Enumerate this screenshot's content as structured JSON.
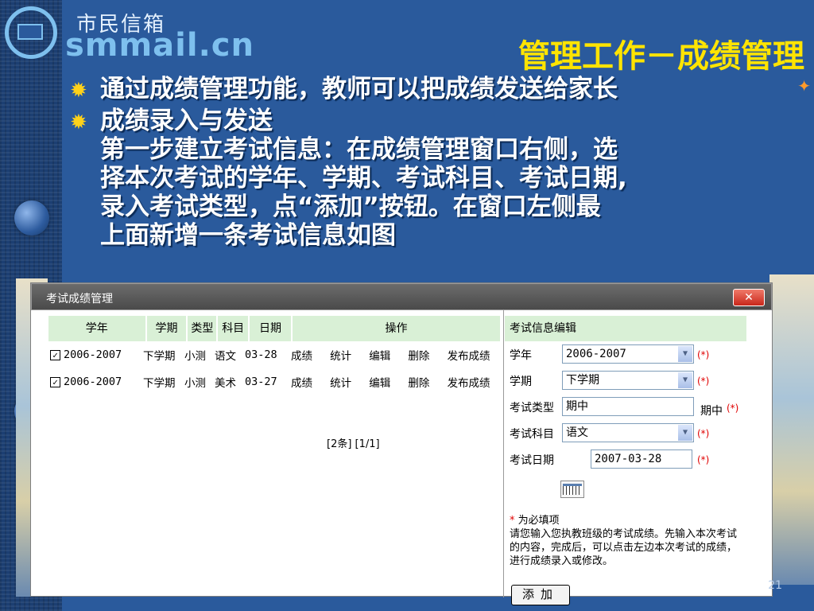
{
  "logo": {
    "cn": "市民信箱",
    "en": "smmail.cn"
  },
  "slide": {
    "title": "管理工作－成绩管理",
    "bullets": [
      "通过成绩管理功能，教师可以把成绩发送给家长",
      "成绩录入与发送"
    ],
    "steps": [
      "第一步建立考试信息：在成绩管理窗口右侧，选",
      "择本次考试的学年、学期、考试科目、考试日期,",
      "录入考试类型，点“添加”按钮。在窗口左侧最",
      "上面新增一条考试信息如图"
    ],
    "page_number": "21"
  },
  "window": {
    "title": "考试成绩管理",
    "close_label": "✕",
    "table": {
      "headers": [
        "学年",
        "学期",
        "类型",
        "科目",
        "日期",
        "操作"
      ],
      "rows": [
        {
          "year": "2006-2007",
          "term": "下学期",
          "type": "小测",
          "subject": "语文",
          "date": "03-28",
          "ops": [
            "成绩",
            "统计",
            "编辑",
            "删除",
            "发布成绩"
          ]
        },
        {
          "year": "2006-2007",
          "term": "下学期",
          "type": "小测",
          "subject": "美术",
          "date": "03-27",
          "ops": [
            "成绩",
            "统计",
            "编辑",
            "删除",
            "发布成绩"
          ]
        }
      ],
      "pager": "[2条] [1/1]"
    },
    "form": {
      "header": "考试信息编辑",
      "year_label": "学年",
      "year_value": "2006-2007",
      "term_label": "学期",
      "term_value": "下学期",
      "type_label": "考试类型",
      "type_value": "期中",
      "type_hint": "期中",
      "subject_label": "考试科目",
      "subject_value": "语文",
      "date_label": "考试日期",
      "date_value": "2007-03-28",
      "required_mark": "(*)",
      "note_star": "*",
      "note_title": "为必填项",
      "note_body": "请您输入您执教班级的考试成绩。先输入本次考试的内容，完成后，可以点击左边本次考试的成绩，进行成绩录入或修改。",
      "add_label": "添加"
    }
  },
  "colors": {
    "background": "#2a5a9c",
    "title": "#ffe400",
    "header_bg": "#d9f0d6",
    "required": "#e00000"
  }
}
